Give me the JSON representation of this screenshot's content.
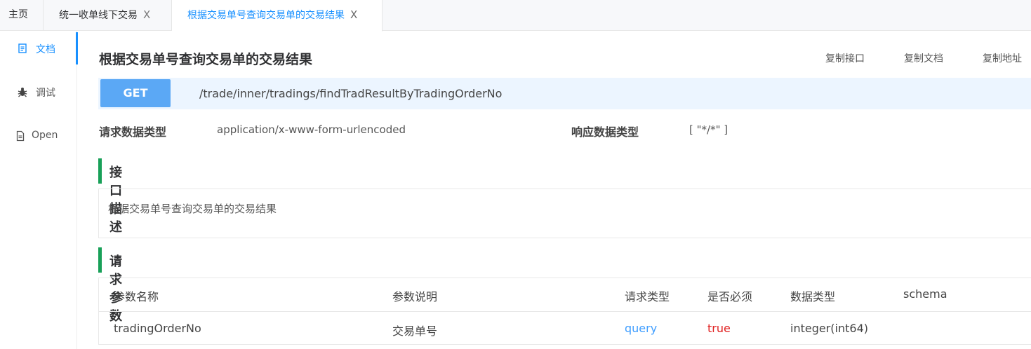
{
  "tabs": [
    {
      "label": "主页",
      "closable": false
    },
    {
      "label": "统一收单线下交易",
      "closable": true
    },
    {
      "label": "根据交易单号查询交易单的交易结果",
      "closable": true,
      "active": true
    }
  ],
  "close_glyph": "X",
  "sidebar": {
    "items": [
      {
        "label": "文档",
        "icon": "document-icon",
        "active": true
      },
      {
        "label": "调试",
        "icon": "bug-icon"
      },
      {
        "label": "Open",
        "icon": "file-icon"
      }
    ]
  },
  "main": {
    "title": "根据交易单号查询交易单的交易结果",
    "actions": [
      "复制接口",
      "复制文档",
      "复制地址"
    ],
    "method": "GET",
    "path": "/trade/inner/tradings/findTradResultByTradingOrderNo",
    "request_type_label": "请求数据类型",
    "request_type_value": "application/x-www-form-urlencoded",
    "response_type_label": "响应数据类型",
    "response_type_value": "[ \"*/*\" ]",
    "description_heading": "接口描述",
    "description": "根据交易单号查询交易单的交易结果",
    "params_heading": "请求参数",
    "params_table": {
      "columns": [
        "参数名称",
        "参数说明",
        "请求类型",
        "是否必须",
        "数据类型",
        "schema"
      ],
      "rows": [
        [
          "tradingOrderNo",
          "交易单号",
          "query",
          "true",
          "integer(int64)",
          ""
        ]
      ]
    }
  },
  "colors": {
    "accent": "#1890ff",
    "method_bg": "#5ba8f5",
    "url_bg": "#ecf5ff",
    "section_bar": "#18a058",
    "query": "#409eff",
    "required_true": "#e02020"
  }
}
